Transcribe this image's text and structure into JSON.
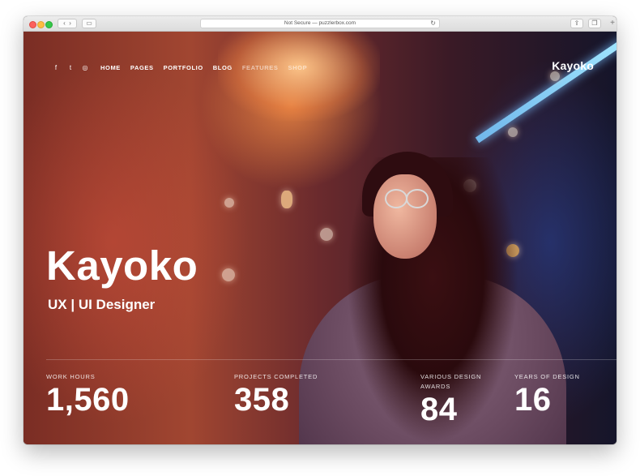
{
  "browser": {
    "url_text": "Not Secure — puzzlerbox.com",
    "reload_icon": "reload-icon",
    "new_tab_icon": "plus-icon"
  },
  "nav": {
    "social": [
      {
        "icon": "facebook-icon",
        "glyph": "f"
      },
      {
        "icon": "twitter-icon",
        "glyph": "t"
      },
      {
        "icon": "instagram-icon",
        "glyph": "◎"
      }
    ],
    "items": [
      "HOME",
      "PAGES",
      "PORTFOLIO",
      "BLOG",
      "FEATURES",
      "SHOP"
    ]
  },
  "logo": "Kayoko",
  "hero": {
    "name": "Kayoko",
    "role": "UX | UI Designer"
  },
  "stats": [
    {
      "label": "WORK HOURS",
      "value": "1,560"
    },
    {
      "label": "PROJECTS COMPLETED",
      "value": "358"
    },
    {
      "label": "VARIOUS DESIGN AWARDS",
      "value": "84"
    },
    {
      "label": "YEARS OF DESIGN",
      "value": "16"
    }
  ],
  "colors": {
    "accent": "#ffffff",
    "neon": "#8fd0ff"
  }
}
